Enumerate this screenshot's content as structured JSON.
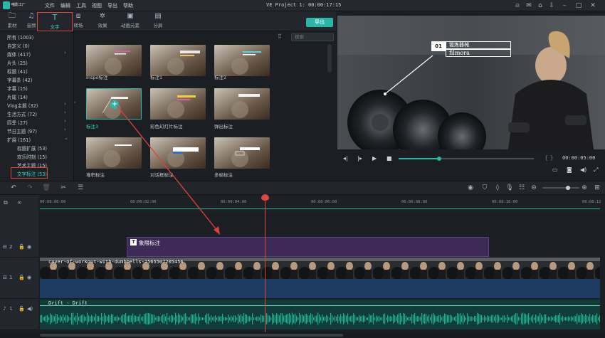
{
  "app": {
    "logo_text": "喵影工厂",
    "title": "VE Project 1: 00:00:17:15"
  },
  "menu": [
    "文件",
    "编辑",
    "工具",
    "视图",
    "导出",
    "帮助"
  ],
  "tabs": [
    {
      "label": "素材",
      "icon": "folder-icon"
    },
    {
      "label": "音频",
      "icon": "music-icon"
    },
    {
      "label": "文字",
      "icon": "text-icon",
      "active": true
    },
    {
      "label": "转场",
      "icon": "transition-icon"
    },
    {
      "label": "效果",
      "icon": "effects-icon"
    },
    {
      "label": "动画元素",
      "icon": "image-icon"
    },
    {
      "label": "分屏",
      "icon": "split-screen-icon"
    }
  ],
  "export_label": "导出",
  "search_placeholder": "搜索",
  "categories": [
    {
      "label": "所有 (1003)"
    },
    {
      "label": "自定义 (0)"
    },
    {
      "label": "媒体 (417)",
      "chevron": true
    },
    {
      "label": "片头 (25)"
    },
    {
      "label": "标题 (41)"
    },
    {
      "label": "字幕条 (42)"
    },
    {
      "label": "字幕 (15)"
    },
    {
      "label": "片尾 (14)"
    },
    {
      "label": "Vlog主题 (32)",
      "chevron": true
    },
    {
      "label": "生活方式 (72)",
      "chevron": true
    },
    {
      "label": "四季 (27)",
      "chevron": true
    },
    {
      "label": "节日主题 (97)",
      "chevron": true
    },
    {
      "label": "扩展 (161)",
      "chevron": true
    },
    {
      "label": "标题扩展 (53)",
      "sub": true
    },
    {
      "label": "欢乐时刻 (15)",
      "sub": true
    },
    {
      "label": "艺术主题 (15)",
      "sub": true
    },
    {
      "label": "文字标注 (53)",
      "sub": true,
      "active": true
    }
  ],
  "thumbnails": [
    {
      "label": "Inspo标注"
    },
    {
      "label": "标注1"
    },
    {
      "label": "标注2"
    },
    {
      "label": "标注3",
      "selected": true
    },
    {
      "label": "彩色幻灯片标注"
    },
    {
      "label": "弹出标注"
    },
    {
      "label": "堆积标注"
    },
    {
      "label": "对话框标注"
    },
    {
      "label": "多帧标注"
    }
  ],
  "preview": {
    "callout_number": "01",
    "callout_title": "锻炼器械",
    "callout_sub": "filmora",
    "time": "00:00:05:00",
    "progress": 0.3
  },
  "timeline": {
    "ruler_ticks": [
      "00:00:00:00",
      "00:00:02:00",
      "00:00:04:00",
      "00:00:06:00",
      "00:00:08:00",
      "00:00:10:00",
      "00:00:12"
    ],
    "tracks": [
      {
        "id": "2",
        "type": "title"
      },
      {
        "id": "1",
        "type": "video"
      },
      {
        "id": "1",
        "type": "audio"
      }
    ],
    "title_clip": "象限标注",
    "video_clip": "cover-of-workout-with-dumbbells-1565507205456",
    "audio_clip": "Drift - Drift"
  },
  "colors": {
    "accent": "#2ab7a9",
    "playhead": "#e04545",
    "highlight": "#e0403a",
    "title_clip": "#3d2a57",
    "video_clip": "#1d3a63",
    "audio_wave": "#1fae8f"
  }
}
